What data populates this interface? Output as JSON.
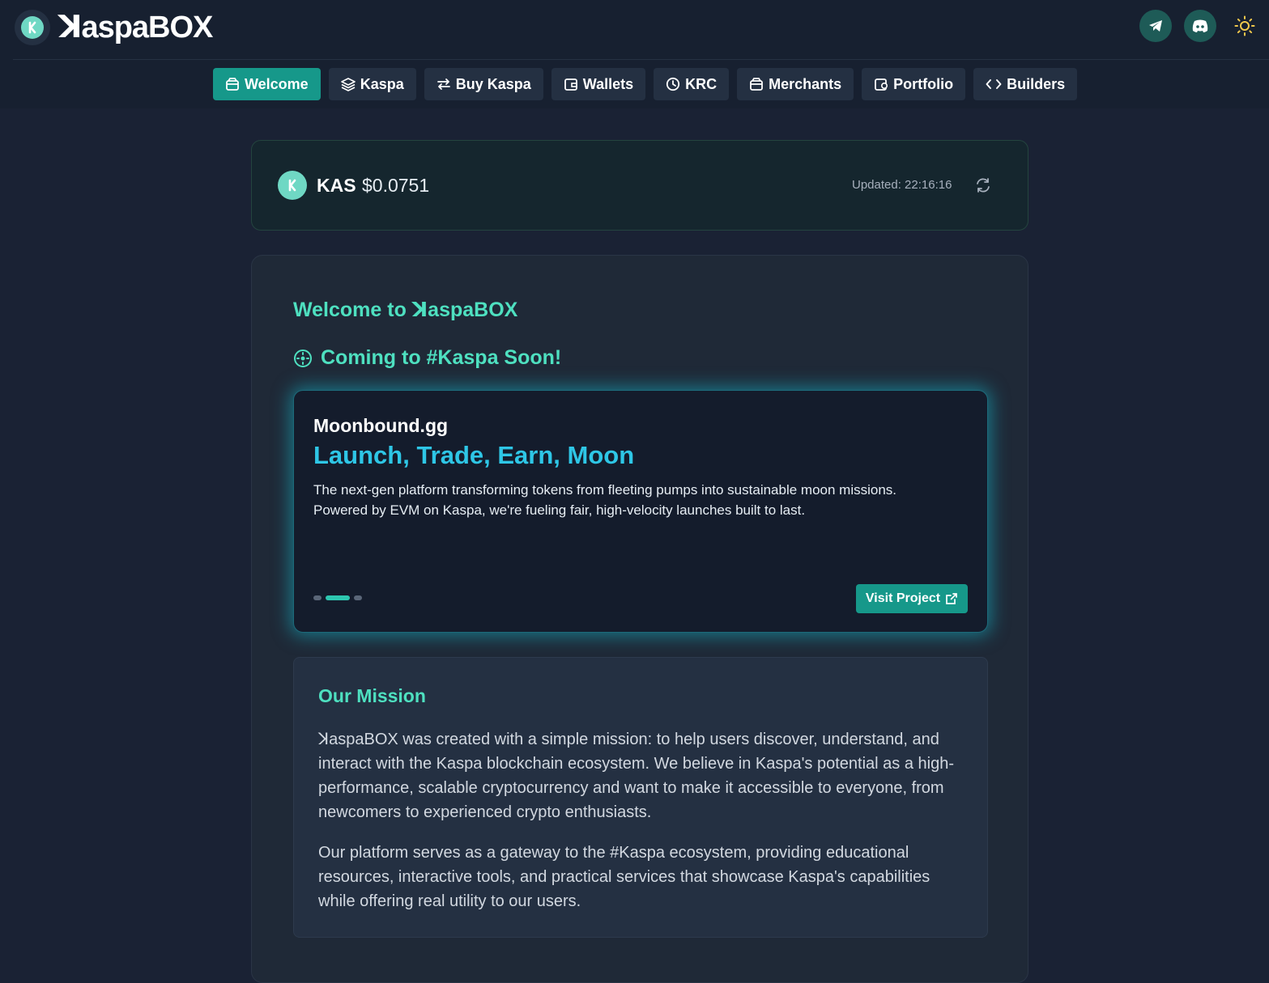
{
  "header": {
    "brand": "ꓘaspaBOX",
    "icons": [
      "telegram-icon",
      "discord-icon",
      "sun-icon"
    ]
  },
  "nav": {
    "items": [
      {
        "label": "Welcome",
        "icon": "box-icon",
        "active": true
      },
      {
        "label": "Kaspa",
        "icon": "layers-icon"
      },
      {
        "label": "Buy Kaspa",
        "icon": "swap-icon"
      },
      {
        "label": "Wallets",
        "icon": "wallet-icon"
      },
      {
        "label": "KRC",
        "icon": "clock-icon"
      },
      {
        "label": "Merchants",
        "icon": "store-icon"
      },
      {
        "label": "Portfolio",
        "icon": "portfolio-icon"
      },
      {
        "label": "Builders",
        "icon": "code-icon"
      }
    ]
  },
  "price": {
    "symbol": "KAS",
    "value": "$0.0751",
    "updated": "Updated: 22:16:16"
  },
  "main": {
    "welcome_title": "Welcome to ꓘaspaBOX",
    "coming_title": "Coming to #Kaspa Soon!",
    "promo": {
      "name": "Moonbound.gg",
      "tagline": "Launch, Trade, Earn, Moon",
      "description": "The next-gen platform transforming tokens from fleeting pumps into sustainable moon missions. Powered by EVM on Kaspa, we're fueling fair, high-velocity launches built to last.",
      "button": "Visit Project",
      "slides": 3,
      "active_slide": 2
    },
    "mission": {
      "title": "Our Mission",
      "p1": "ꓘaspaBOX was created with a simple mission: to help users discover, understand, and interact with the Kaspa blockchain ecosystem. We believe in Kaspa's potential as a high-performance, scalable cryptocurrency and want to make it accessible to everyone, from newcomers to experienced crypto enthusiasts.",
      "p2": "Our platform serves as a gateway to the #Kaspa ecosystem, providing educational resources, interactive tools, and practical services that showcase Kaspa's capabilities while offering real utility to our users."
    }
  },
  "colors": {
    "accent": "#4ee0c0",
    "button": "#16988a",
    "background": "#1a2234"
  }
}
